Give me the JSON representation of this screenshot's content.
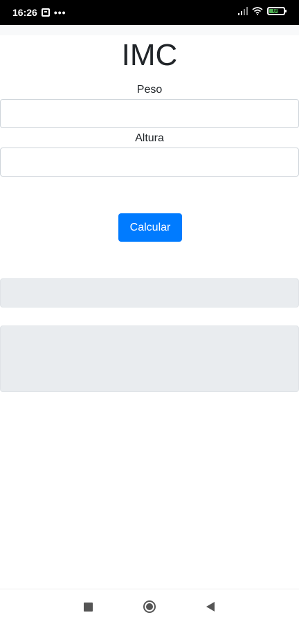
{
  "status_bar": {
    "time": "16:26",
    "notification_icon": "notification-icon",
    "more_indicator": "•••",
    "signal_icon": "signal-icon",
    "wifi_icon": "wifi-icon",
    "battery_icon": "battery-icon",
    "battery_level": "66",
    "battery_fraction": 0.66,
    "battery_color": "#4caf50"
  },
  "app": {
    "title": "IMC",
    "peso_label": "Peso",
    "peso_value": "",
    "altura_label": "Altura",
    "altura_value": "",
    "calcular_button": "Calcular",
    "result_imc": "",
    "result_classificacao": "",
    "accent_color": "#007bff",
    "result_bg_color": "#e9ecef"
  },
  "nav_bar": {
    "recent_icon": "recent-apps-icon",
    "home_icon": "home-icon",
    "back_icon": "back-icon"
  }
}
